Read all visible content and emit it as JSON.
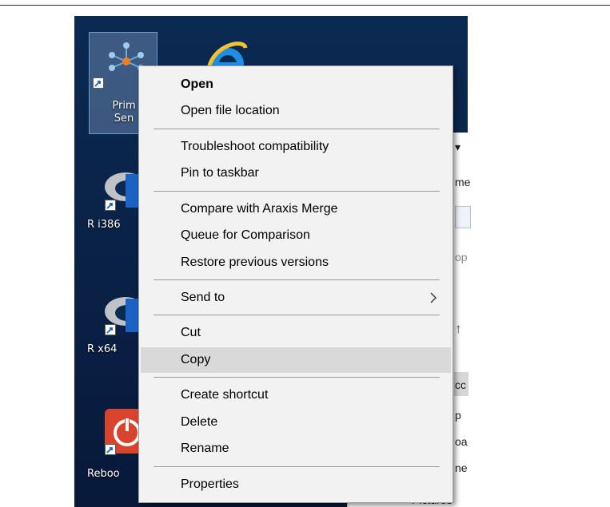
{
  "desktop": {
    "icons": [
      {
        "label": "Prim\nSen",
        "icon": "network-app-icon"
      },
      {
        "label": "",
        "icon": "internet-explorer-icon"
      },
      {
        "label": "R i386",
        "icon": "r-language-icon"
      },
      {
        "label": "R x64",
        "icon": "r-language-icon"
      },
      {
        "label": "Reboo",
        "icon": "reboot-icon"
      }
    ]
  },
  "explorer_fragments": [
    "▾",
    "me",
    "op",
    "↑",
    "cc",
    "p",
    "oa",
    "ne",
    "Pictures"
  ],
  "context_menu": {
    "groups": [
      [
        {
          "label": "Open",
          "bold": true
        },
        {
          "label": "Open file location"
        }
      ],
      [
        {
          "label": "Troubleshoot compatibility"
        },
        {
          "label": "Pin to taskbar"
        }
      ],
      [
        {
          "label": "Compare with Araxis Merge"
        },
        {
          "label": "Queue for Comparison"
        },
        {
          "label": "Restore previous versions"
        }
      ],
      [
        {
          "label": "Send to",
          "submenu": true
        }
      ],
      [
        {
          "label": "Cut"
        },
        {
          "label": "Copy",
          "highlighted": true
        }
      ],
      [
        {
          "label": "Create shortcut"
        },
        {
          "label": "Delete"
        },
        {
          "label": "Rename"
        }
      ],
      [
        {
          "label": "Properties"
        }
      ]
    ]
  },
  "colors": {
    "desktop_bg": "#0b2a52",
    "menu_bg": "#f2f2f2",
    "menu_highlight": "#d9d9d9",
    "reboot_red": "#d9442f"
  }
}
